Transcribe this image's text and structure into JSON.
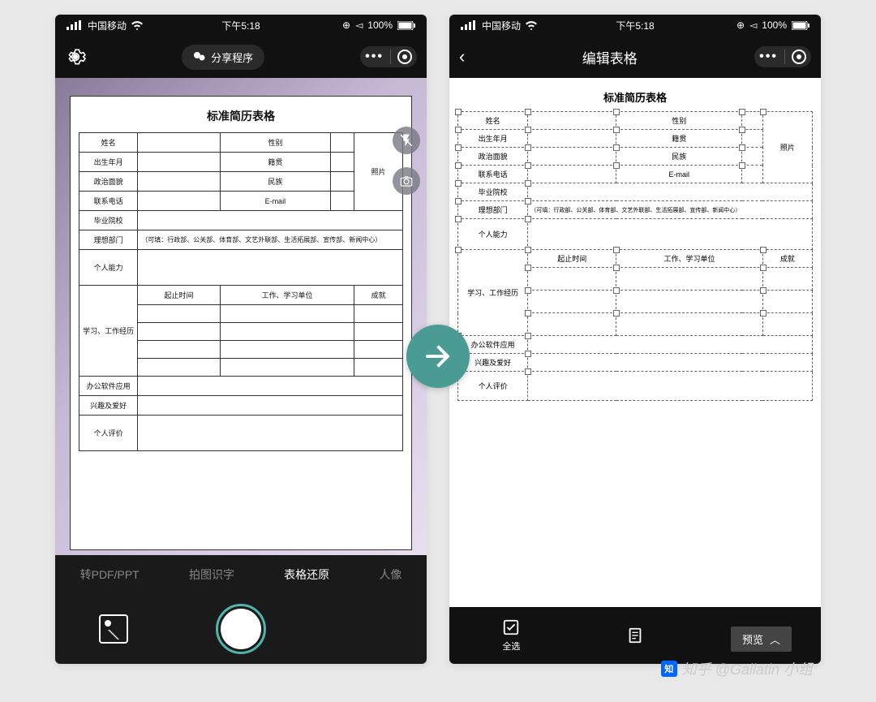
{
  "statusbar": {
    "carrier": "中国移动",
    "time": "下午5:18",
    "battery": "100%"
  },
  "left": {
    "share_label": "分享程序",
    "doc_title": "标准简历表格",
    "form": {
      "name": "姓名",
      "gender": "性别",
      "birth": "出生年月",
      "origin": "籍贯",
      "political": "政治面貌",
      "ethnic": "民族",
      "phone": "联系电话",
      "email": "E-mail",
      "school": "毕业院校",
      "dept": "理想部门",
      "dept_hint": "（可填：行政部、公关部、体育部、文艺外联部、生活拓展部、宣传部、新闻中心）",
      "ability": "个人能力",
      "exp": "学习、工作经历",
      "exp_cols": {
        "time": "起止时间",
        "unit": "工作、学习单位",
        "result": "成就"
      },
      "software": "办公软件应用",
      "hobby": "兴趣及爱好",
      "eval": "个人评价",
      "photo": "照片"
    },
    "tabs": {
      "pdf": "转PDF/PPT",
      "ocr": "拍图识字",
      "table": "表格还原",
      "portrait": "人像"
    }
  },
  "right": {
    "title": "编辑表格",
    "bottom": {
      "all": "全选",
      "edit": "",
      "export": ""
    }
  },
  "preview": "预览",
  "watermark": "知乎 @Gallatin 小组"
}
